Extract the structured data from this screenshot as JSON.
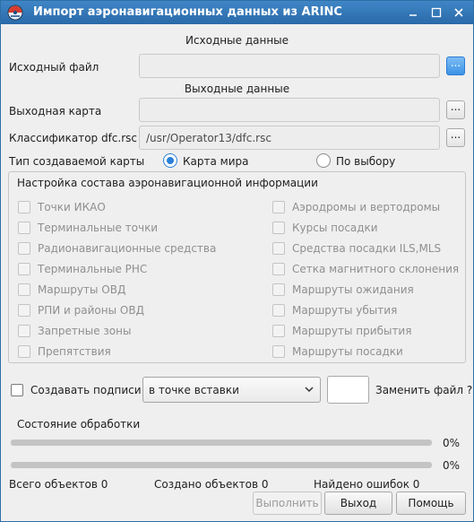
{
  "window": {
    "title": "Импорт аэронавигационных данных из ARINC",
    "icon": "app-globe-icon"
  },
  "source": {
    "section_title": "Исходные данные",
    "file_label": "Исходный файл",
    "file_value": "",
    "browse_label": "..."
  },
  "output": {
    "section_title": "Выходные данные",
    "map_label": "Выходная карта",
    "map_value": "",
    "map_browse_label": "...",
    "classifier_label": "Классификатор dfc.rsc",
    "classifier_value": "/usr/Operator13/dfc.rsc",
    "classifier_browse_label": "..."
  },
  "map_type": {
    "label": "Тип создаваемой карты",
    "options": [
      {
        "label": "Карта мира",
        "selected": true
      },
      {
        "label": "По выбору",
        "selected": false
      }
    ]
  },
  "composition": {
    "title": "Настройка состава аэронавигационной информации",
    "left_items": [
      {
        "label": "Точки ИКАО",
        "checked": false
      },
      {
        "label": "Терминальные точки",
        "checked": false
      },
      {
        "label": "Радионавигационные средства",
        "checked": false
      },
      {
        "label": "Терминальные РНС",
        "checked": false
      },
      {
        "label": "Маршруты ОВД",
        "checked": false
      },
      {
        "label": "РПИ и районы ОВД",
        "checked": false
      },
      {
        "label": "Запретные зоны",
        "checked": false
      },
      {
        "label": "Препятствия",
        "checked": false
      }
    ],
    "right_items": [
      {
        "label": "Аэродромы и вертодромы",
        "checked": false
      },
      {
        "label": "Курсы посадки",
        "checked": false
      },
      {
        "label": "Средства посадки ILS,MLS",
        "checked": false
      },
      {
        "label": "Сетка магнитного склонения",
        "checked": false
      },
      {
        "label": "Маршруты ожидания",
        "checked": false
      },
      {
        "label": "Маршруты убытия",
        "checked": false
      },
      {
        "label": "Маршруты прибытия",
        "checked": false
      },
      {
        "label": "Маршруты посадки",
        "checked": false
      }
    ]
  },
  "signatures": {
    "label": "Создавать подписи",
    "checked": false,
    "placement_value": "в точке вставки",
    "count_value": "",
    "replace_label": "Заменить файл ?"
  },
  "processing": {
    "title": "Состояние обработки",
    "bar1_percent": 0,
    "bar1_label": "0%",
    "bar2_percent": 0,
    "bar2_label": "0%"
  },
  "stats": {
    "total": "Всего объектов 0",
    "created": "Создано объектов 0",
    "errors": "Найдено ошибок 0"
  },
  "buttons": {
    "run": "Выполнить",
    "exit": "Выход",
    "help": "Помощь"
  },
  "colors": {
    "titlebar": "#2f77b8",
    "accent": "#2a7fd9"
  }
}
